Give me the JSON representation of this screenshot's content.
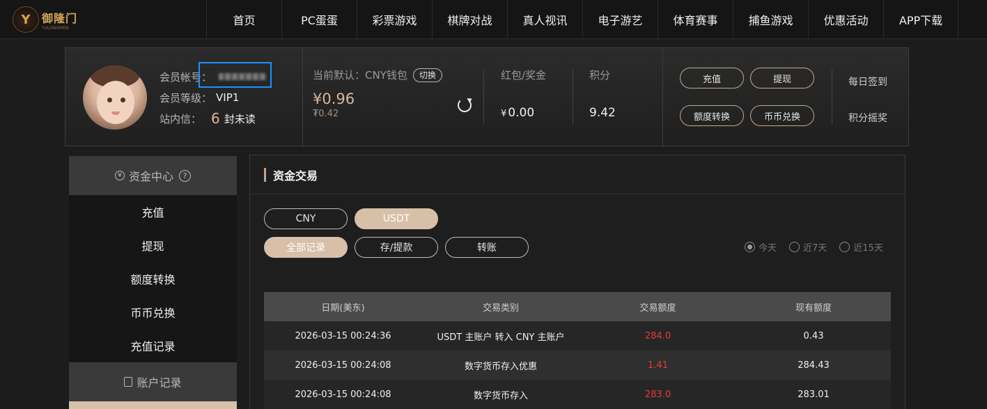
{
  "brand": {
    "logo_text": "御隆门",
    "logo_sub": "YULONGMEN",
    "logo_mark": "Y"
  },
  "nav": [
    "首页",
    "PC蛋蛋",
    "彩票游戏",
    "棋牌对战",
    "真人视讯",
    "电子游艺",
    "体育赛事",
    "捕鱼游戏",
    "优惠活动",
    "APP下载"
  ],
  "member": {
    "account_label": "会员帐号：",
    "level_label": "会员等级：",
    "level_value": "VIP1",
    "mail_label": "站内信：",
    "mail_count": "6",
    "mail_suffix": "封未读"
  },
  "wallet": {
    "label": "当前默认：CNY钱包",
    "switch_label": "切换",
    "amount": "¥0.96",
    "sub_amount": "₮0.42"
  },
  "bonus": {
    "label": "红包/奖金",
    "currency": "¥",
    "value": "0.00"
  },
  "points": {
    "label": "积分",
    "value": "9.42"
  },
  "actions": {
    "deposit": "充值",
    "withdraw": "提现",
    "transfer": "额度转换",
    "exchange": "币币兑换",
    "checkin": "每日签到",
    "lottery": "积分摇奖"
  },
  "sidebar": {
    "fund_center": "资金中心",
    "items": [
      "充值",
      "提现",
      "额度转换",
      "币币兑换",
      "充值记录"
    ],
    "account_records": "账户记录"
  },
  "main": {
    "title": "资金交易",
    "currency_tabs": [
      "CNY",
      "USDT"
    ],
    "record_tabs": [
      "全部记录",
      "存/提款",
      "转账"
    ],
    "range": [
      "今天",
      "近7天",
      "近15天"
    ]
  },
  "table": {
    "headers": [
      "日期(美东)",
      "交易类别",
      "交易额度",
      "现有额度"
    ],
    "rows": [
      [
        "2026-03-15 00:24:36",
        "USDT 主账户 转入 CNY 主账户",
        "284.0",
        "0.43"
      ],
      [
        "2026-03-15 00:24:08",
        "数字货币存入优惠",
        "1.41",
        "284.43"
      ],
      [
        "2026-03-15 00:24:08",
        "数字货币存入",
        "283.0",
        "283.01"
      ]
    ]
  }
}
